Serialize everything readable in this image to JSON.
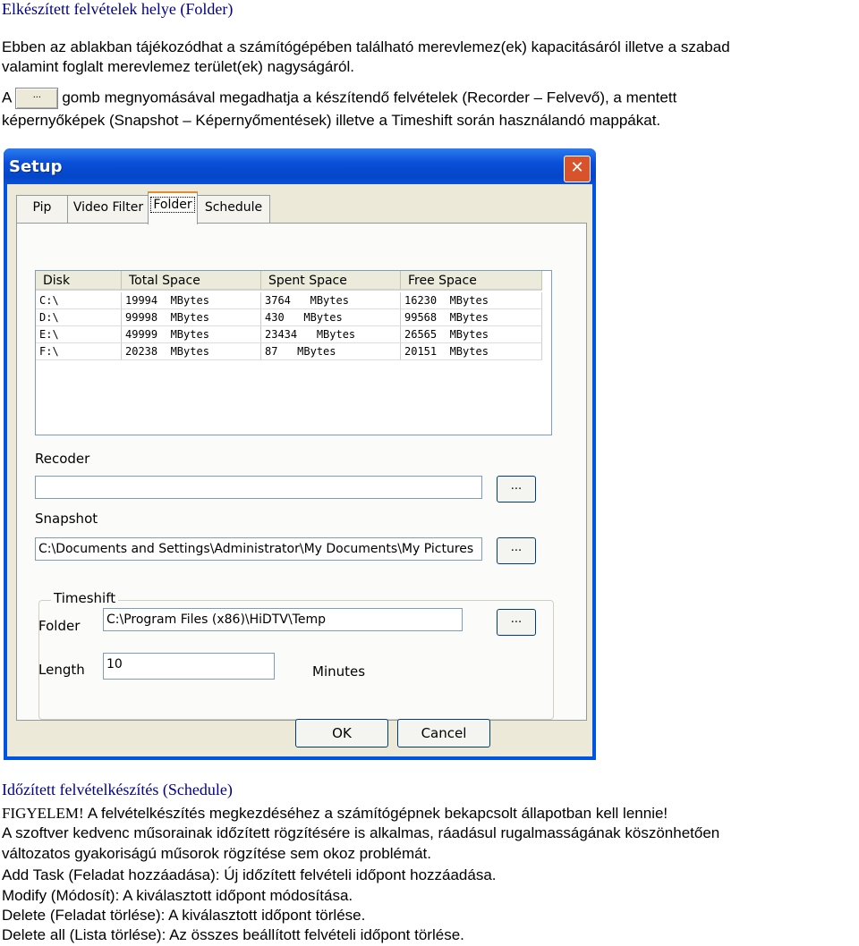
{
  "doc": {
    "title": "Elkészített felvételek helye (Folder)",
    "intro_line1": "Ebben az ablakban tájékozódhat a számítógépében található merevlemez(ek) kapacitásáról illetve a szabad",
    "intro_line2": "valamint foglalt merevlemez terület(ek) nagyságáról.",
    "para2_prefix": "A",
    "para2_button": "...",
    "para2_line1": "gomb megnyomásával megadhatja a készítendő felvételek (Recorder – Felvevő), a mentett",
    "para2_line2": "képernyőképek (Snapshot – Képernyőmentések) illetve a Timeshift során használandó mappákat."
  },
  "window": {
    "title": "Setup",
    "close": "✕",
    "tabs": [
      {
        "label": "Pip"
      },
      {
        "label": "Video Filter"
      },
      {
        "label": "Folder"
      },
      {
        "label": "Schedule"
      }
    ],
    "disk_table": {
      "headers": [
        "Disk",
        "Total Space",
        "Spent Space",
        "Free Space"
      ],
      "rows": [
        {
          "disk": "C:\\",
          "total": "19994",
          "total_unit": "MBytes",
          "spent": "3764",
          "spent_unit": "MBytes",
          "free": "16230",
          "free_unit": "MBytes"
        },
        {
          "disk": "D:\\",
          "total": "99998",
          "total_unit": "MBytes",
          "spent": "430",
          "spent_unit": "MBytes",
          "free": "99568",
          "free_unit": "MBytes"
        },
        {
          "disk": "E:\\",
          "total": "49999",
          "total_unit": "MBytes",
          "spent": "23434",
          "spent_unit": "MBytes",
          "free": "26565",
          "free_unit": "MBytes"
        },
        {
          "disk": "F:\\",
          "total": "20238",
          "total_unit": "MBytes",
          "spent": "87",
          "spent_unit": "MBytes",
          "free": "20151",
          "free_unit": "MBytes"
        }
      ]
    },
    "recorder_label": "Recoder",
    "recorder_value": "",
    "snapshot_label": "Snapshot",
    "snapshot_value": "C:\\Documents and Settings\\Administrator\\My Documents\\My Pictures",
    "browse_label": "...",
    "timeshift": {
      "title": "Timeshift",
      "folder_label": "Folder",
      "folder_value": "C:\\Program Files (x86)\\HiDTV\\Temp",
      "length_label": "Length",
      "length_value": "10",
      "minutes_label": "Minutes"
    },
    "ok_label": "OK",
    "cancel_label": "Cancel"
  },
  "schedule_section": {
    "title": "Időzített felvételkészítés (Schedule)",
    "warning_prefix": "FIGYELEM!",
    "warning_text": "A felvételkészítés megkezdéséhez a számítógépnek bekapcsolt állapotban kell lennie!",
    "line2": "A szoftver kedvenc műsorainak időzített rögzítésére is alkalmas, ráadásul rugalmasságának köszönhetően",
    "line3": "változatos gyakoriságú műsorok rögzítése sem okoz problémát.",
    "line4": "Add Task (Feladat hozzáadása): Új időzített felvételi időpont hozzáadása.",
    "line5": "Modify (Módosít): A kiválasztott időpont módosítása.",
    "line6": "Delete (Feladat törlése): A kiválasztott időpont törlése.",
    "line7": "Delete all (Lista törlése): Az összes beállított felvételi időpont törlése."
  }
}
